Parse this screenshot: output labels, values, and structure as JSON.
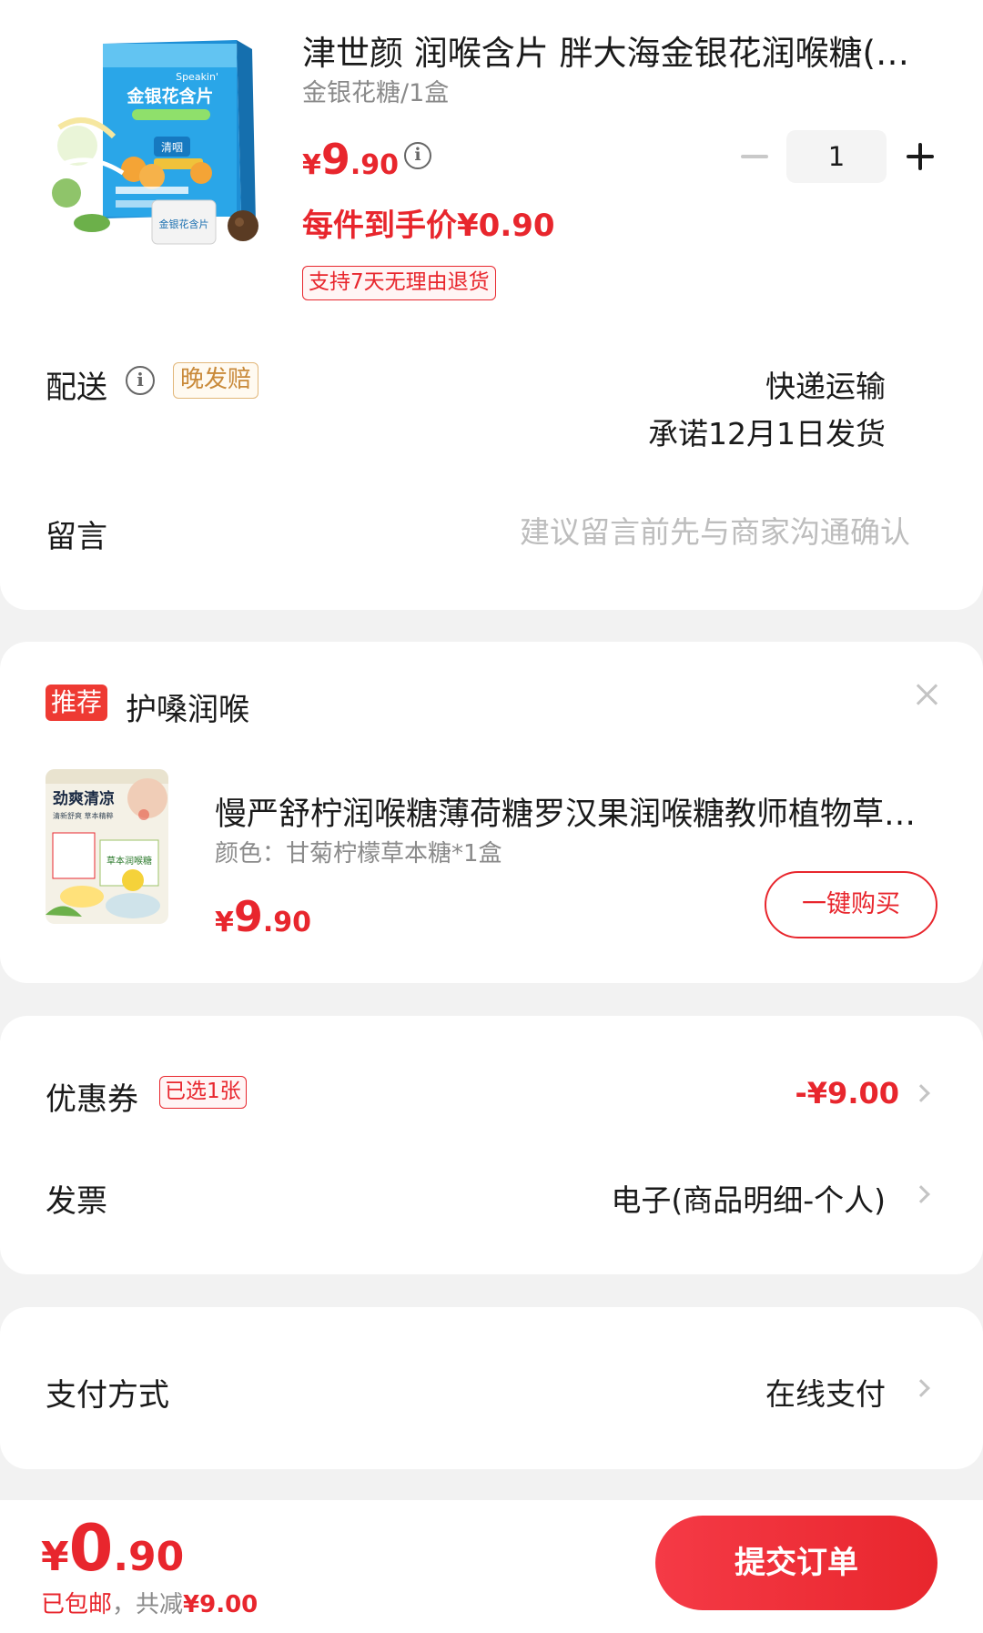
{
  "product": {
    "title": "津世颜 润喉含片 胖大海金银花润喉糖(非…",
    "spec": "金银花糖/1盒",
    "price_symbol": "¥",
    "price_int": "9",
    "price_dec": ".90",
    "net_price": "每件到手价¥0.90",
    "return_policy": "支持7天无理由退货",
    "quantity": "1",
    "image_text": {
      "brand": "Speakin'",
      "name": "金银花含片",
      "sub": "清咽",
      "candy_label": "金银花含片"
    }
  },
  "delivery": {
    "label": "配送",
    "late_tag": "晚发赔",
    "method": "快递运输",
    "promise": "承诺12月1日发货"
  },
  "message": {
    "label": "留言",
    "placeholder": "建议留言前先与商家沟通确认"
  },
  "recommend": {
    "badge": "推荐",
    "title": "护嗓润喉",
    "product_name": "慢严舒柠润喉糖薄荷糖罗汉果润喉糖教师植物草…",
    "spec": "颜色：甘菊柠檬草本糖*1盒",
    "price_symbol": "¥",
    "price_int": "9",
    "price_dec": ".90",
    "buy_label": "一键购买",
    "image_text": {
      "headline": "劲爽清凉",
      "sub": "清新舒爽 草本精粹",
      "box": "草本润喉糖"
    }
  },
  "coupon": {
    "label": "优惠券",
    "tag": "已选1张",
    "value": "-¥9.00"
  },
  "invoice": {
    "label": "发票",
    "value": "电子(商品明细-个人)"
  },
  "payment": {
    "label": "支付方式",
    "value": "在线支付"
  },
  "footer": {
    "total_symbol": "¥",
    "total_int": "0",
    "total_dec": ".90",
    "shipping": "已包邮",
    "separator": "，共减",
    "saved": "¥9.00",
    "submit_label": "提交订单"
  },
  "colors": {
    "accent": "#e8262d",
    "background": "#f2f2f2",
    "card": "#ffffff",
    "muted_text": "#8a8a8a"
  }
}
